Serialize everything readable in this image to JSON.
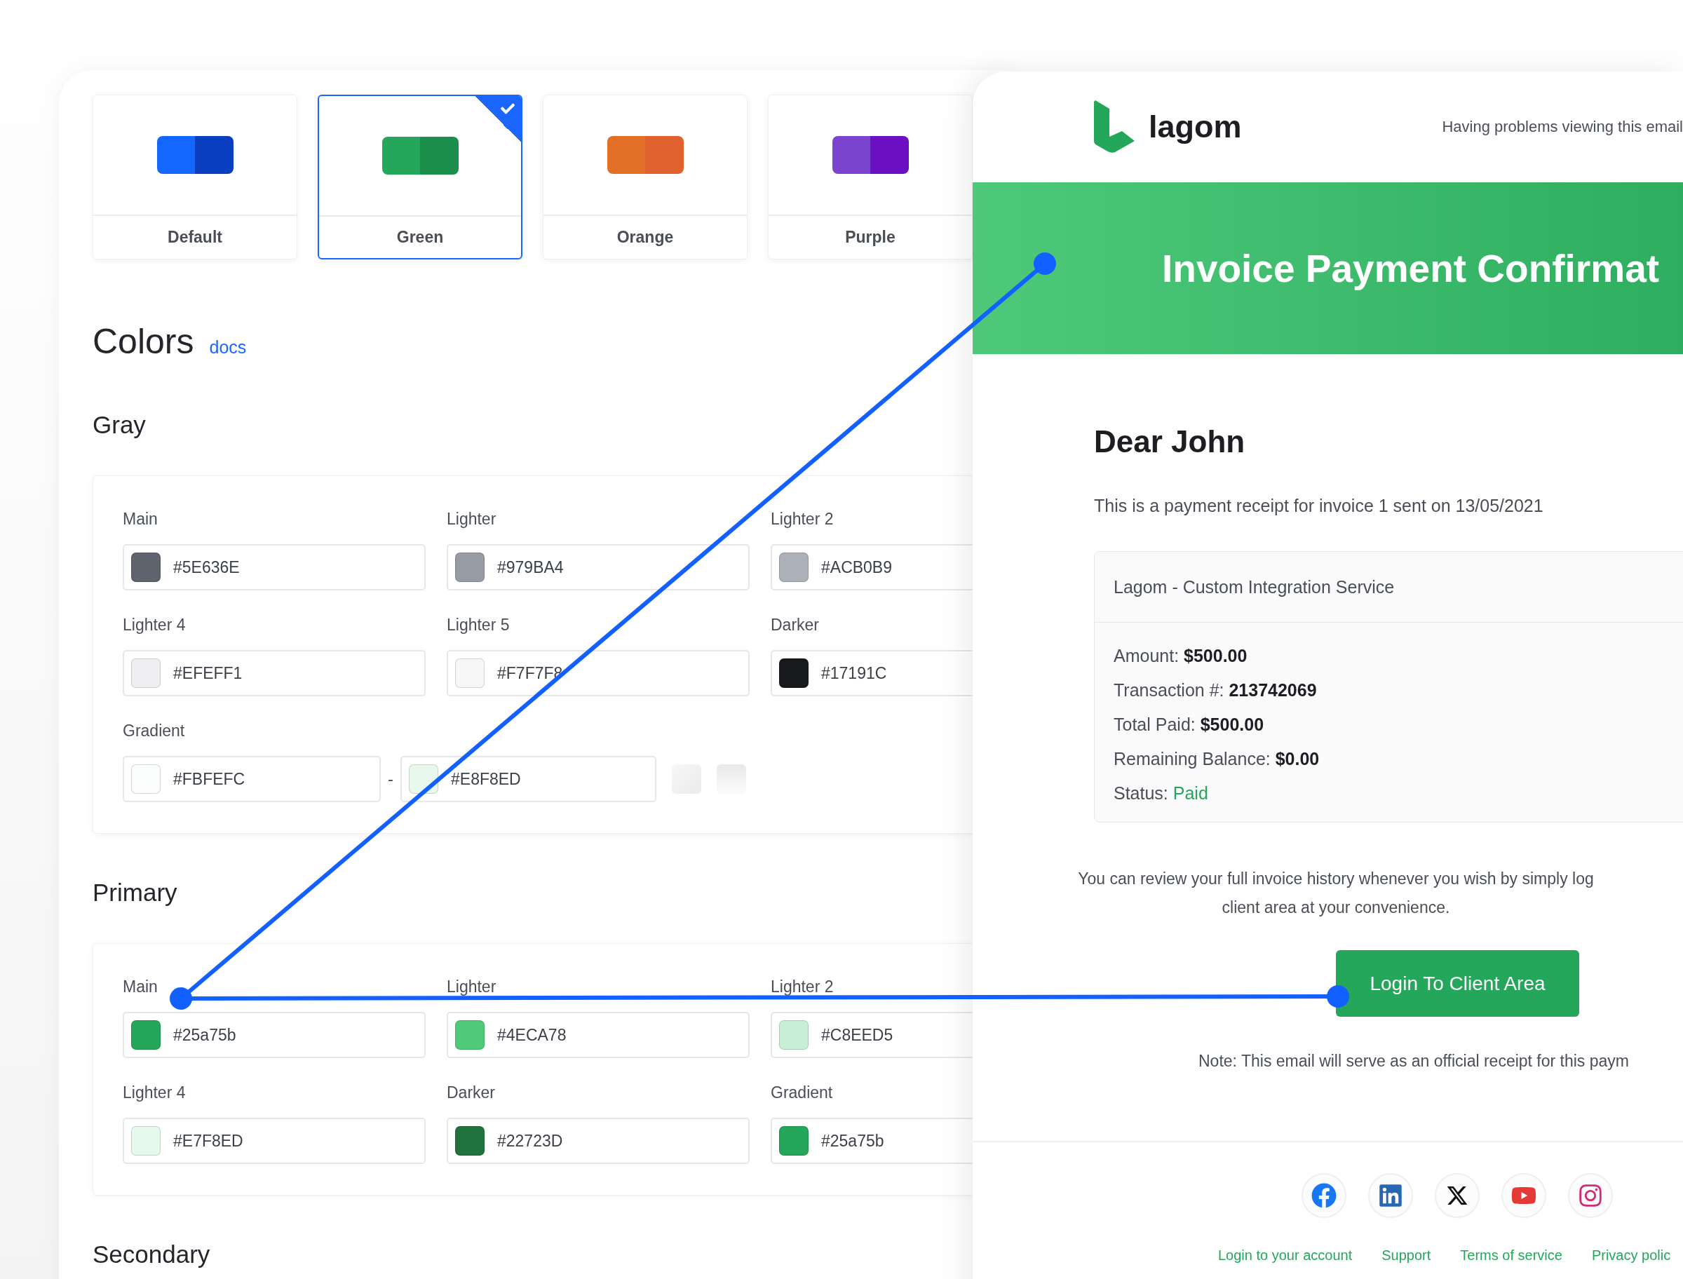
{
  "themes": [
    {
      "label": "Default",
      "swatch": [
        {
          "color": "#1366ff"
        },
        {
          "color": "#0a3fbf"
        }
      ],
      "selected": false
    },
    {
      "label": "Green",
      "swatch": [
        {
          "color": "#25a75b"
        },
        {
          "color": "#1c8f4c"
        }
      ],
      "selected": true
    },
    {
      "label": "Orange",
      "swatch": [
        {
          "color": "#e16f26"
        },
        {
          "color": "#e0602e"
        }
      ],
      "selected": false
    },
    {
      "label": "Purple",
      "swatch": [
        {
          "color": "#7a44cf"
        },
        {
          "color": "#6a10c2"
        }
      ],
      "selected": false
    }
  ],
  "colors_section": {
    "title": "Colors",
    "docs_link": "docs"
  },
  "groups": [
    {
      "title": "Gray",
      "fields": [
        {
          "kind": "color",
          "label": "Main",
          "value": "#5E636E",
          "color": "#5e636e"
        },
        {
          "kind": "color",
          "label": "Lighter",
          "value": "#979BA4",
          "color": "#979ba4"
        },
        {
          "kind": "color",
          "label": "Lighter 2",
          "value": "#ACB0B9",
          "color": "#acb0b9"
        },
        {
          "kind": "color",
          "label": "Lighter 4",
          "value": "#EFEFF1",
          "color": "#efeff1"
        },
        {
          "kind": "color",
          "label": "Lighter 5",
          "value": "#F7F7F8",
          "color": "#f7f7f8"
        },
        {
          "kind": "color",
          "label": "Darker",
          "value": "#17191C",
          "color": "#17191c"
        },
        {
          "kind": "gradient",
          "label": "Gradient",
          "from": {
            "value": "#FBFEFC",
            "color": "#fbfefc"
          },
          "separator": "-",
          "to": {
            "value": "#E8F8ED",
            "color": "#e8f8ed"
          }
        }
      ]
    },
    {
      "title": "Primary",
      "fields": [
        {
          "kind": "color",
          "label": "Main",
          "value": "#25a75b",
          "color": "#25a75b"
        },
        {
          "kind": "color",
          "label": "Lighter",
          "value": "#4ECA78",
          "color": "#4eca78"
        },
        {
          "kind": "color",
          "label": "Lighter 2",
          "value": "#C8EED5",
          "color": "#c8eed5"
        },
        {
          "kind": "color",
          "label": "Lighter 4",
          "value": "#E7F8ED",
          "color": "#e7f8ed"
        },
        {
          "kind": "color",
          "label": "Darker",
          "value": "#22723D",
          "color": "#22723d"
        },
        {
          "kind": "color",
          "label": "Gradient",
          "value": "#25a75b",
          "color": "#25a75b"
        }
      ]
    },
    {
      "title": "Secondary"
    }
  ],
  "email": {
    "logo_text": "lagom",
    "header_link": "Having problems viewing this email",
    "banner_title": "Invoice Payment Confirmat",
    "greeting": "Dear John",
    "intro": "This is a payment receipt for invoice 1 sent on 13/05/2021",
    "service": {
      "title": "Lagom - Custom Integration Service",
      "lines": [
        {
          "kind": "plain",
          "label": "Amount:",
          "value": "$500.00"
        },
        {
          "kind": "plain",
          "label": "Transaction #:",
          "value": "213742069"
        },
        {
          "kind": "plain",
          "label": "Total Paid:",
          "value": "$500.00"
        },
        {
          "kind": "plain",
          "label": "Remaining Balance:",
          "value": "$0.00"
        },
        {
          "kind": "status",
          "label": "Status:",
          "value": "Paid"
        }
      ]
    },
    "review_lines": [
      "You can review your full invoice history whenever you wish by simply log",
      "client area at your convenience."
    ],
    "button": "Login To Client Area",
    "note": "Note: This email will serve as an official receipt for this paym",
    "socials": [
      {
        "kind": "facebook"
      },
      {
        "kind": "linkedin"
      },
      {
        "kind": "x"
      },
      {
        "kind": "youtube"
      },
      {
        "kind": "instagram"
      }
    ],
    "footer_links": [
      "Login to your account",
      "Support",
      "Terms of service",
      "Privacy polic"
    ]
  }
}
